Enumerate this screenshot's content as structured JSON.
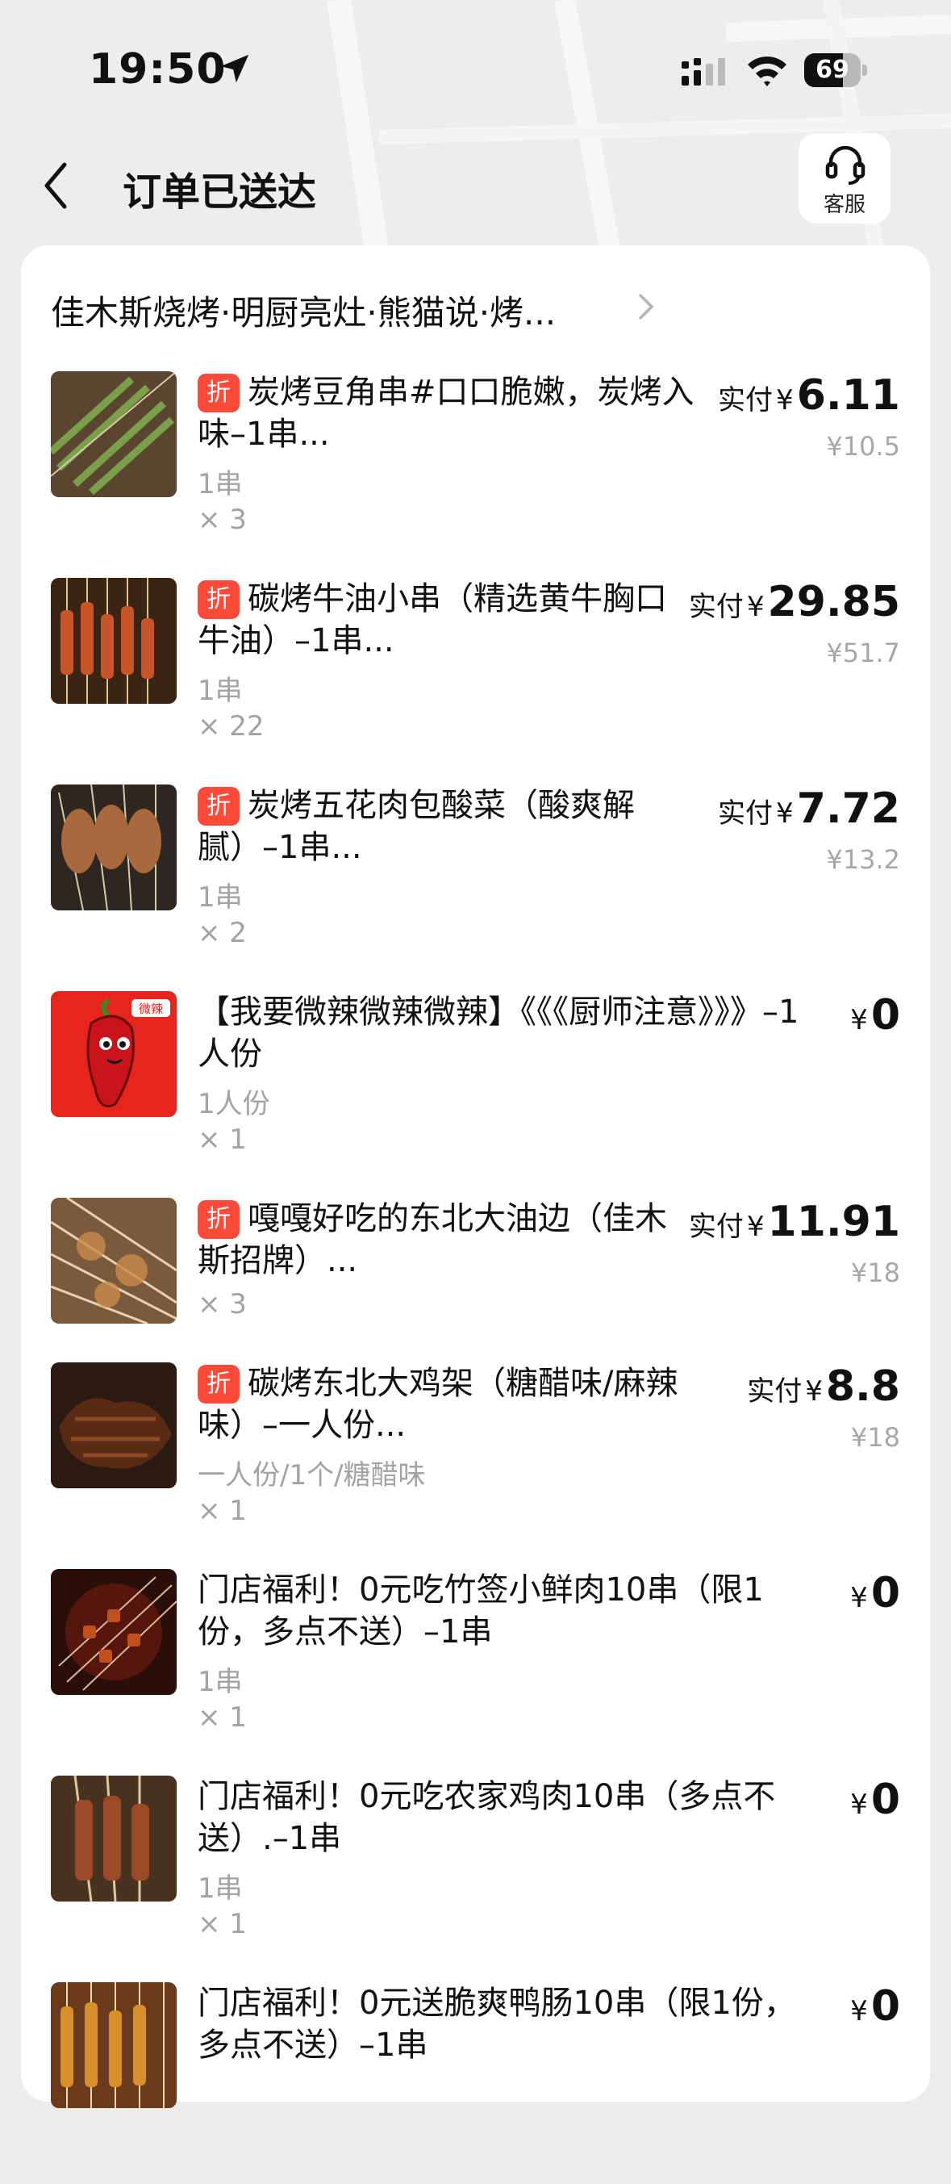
{
  "status_bar": {
    "time": "19:50",
    "battery": "69",
    "battery_level": 0.69
  },
  "nav": {
    "title": "订单已送达",
    "service_label": "客服"
  },
  "store": {
    "name": "佳木斯烧烤·明厨亮灶·熊猫说·烤..."
  },
  "currency": "¥",
  "paid_label": "实付",
  "discount_badge": "折",
  "items": [
    {
      "name": "炭烤豆角串#口口脆嫩，炭烤入味–1串...",
      "spec": "1串",
      "qty": "× 3",
      "paid": "6.11",
      "original": "¥10.5",
      "discount": true
    },
    {
      "name": "碳烤牛油小串（精选黄牛胸口牛油）–1串...",
      "spec": "1串",
      "qty": "× 22",
      "paid": "29.85",
      "original": "¥51.7",
      "discount": true
    },
    {
      "name": "炭烤五花肉包酸菜（酸爽解腻）–1串...",
      "spec": "1串",
      "qty": "× 2",
      "paid": "7.72",
      "original": "¥13.2",
      "discount": true
    },
    {
      "name": "【我要微辣微辣微辣】《《《厨师注意》》》–1人份",
      "spec": "1人份",
      "qty": "× 1",
      "paid": "0",
      "original": "",
      "discount": false,
      "thumb_badge": "微辣"
    },
    {
      "name": "嘎嘎好吃的东北大油边（佳木斯招牌）...",
      "spec": "",
      "qty": "× 3",
      "paid": "11.91",
      "original": "¥18",
      "discount": true
    },
    {
      "name": "碳烤东北大鸡架（糖醋味/麻辣味）–一人份...",
      "spec": "一人份/1个/糖醋味",
      "qty": "× 1",
      "paid": "8.8",
      "original": "¥18",
      "discount": true
    },
    {
      "name": "门店福利！0元吃竹签小鲜肉10串（限1份，多点不送）–1串",
      "spec": "1串",
      "qty": "× 1",
      "paid": "0",
      "original": "",
      "discount": false
    },
    {
      "name": "门店福利！0元吃农家鸡肉10串（多点不送）.–1串",
      "spec": "1串",
      "qty": "× 1",
      "paid": "0",
      "original": "",
      "discount": false
    },
    {
      "name": "门店福利！0元送脆爽鸭肠10串（限1份，多点不送）–1串",
      "spec": "1串",
      "qty": "× 1",
      "paid": "0",
      "original": "",
      "discount": false
    }
  ]
}
